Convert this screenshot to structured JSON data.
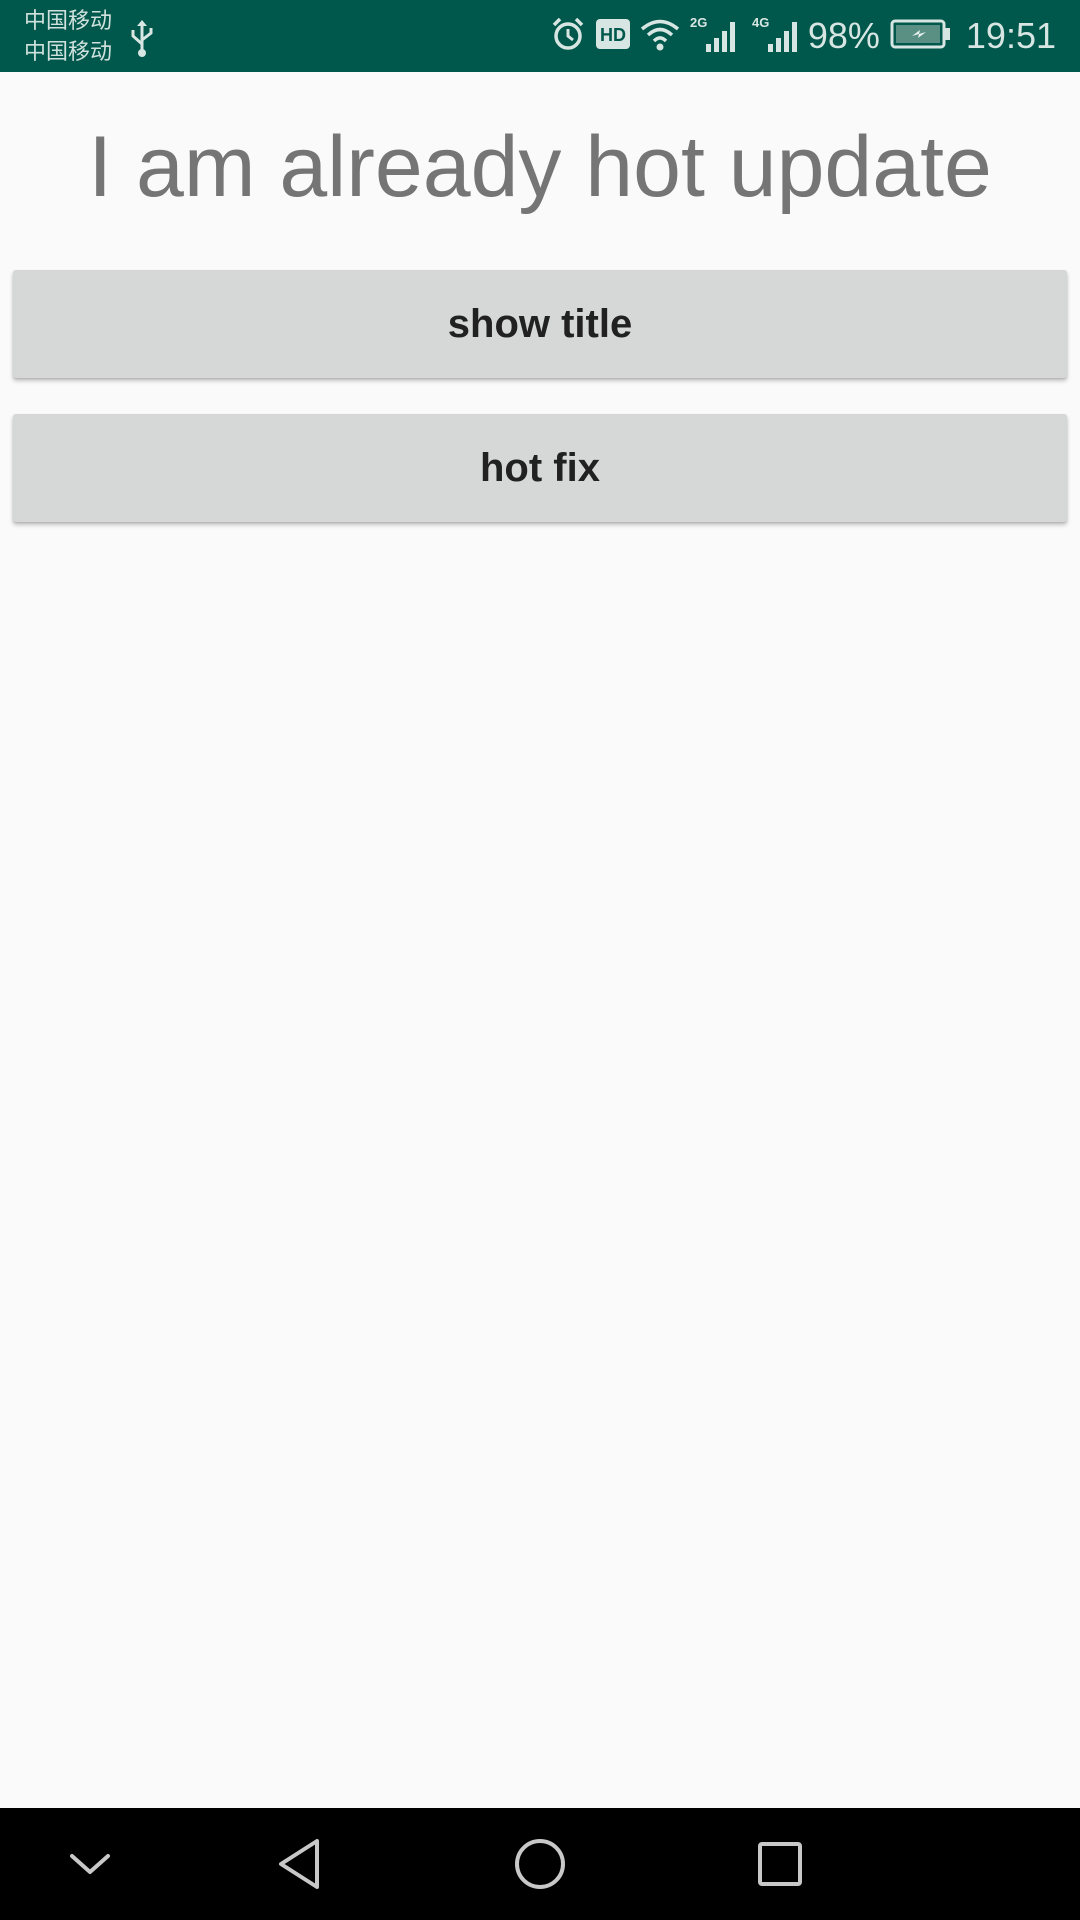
{
  "status_bar": {
    "carrier_1": "中国移动",
    "carrier_2": "中国移动",
    "network_2g": "2G",
    "network_4g": "4G",
    "battery_percent": "98%",
    "time": "19:51",
    "hd_badge": "HD",
    "icons": [
      "usb-icon",
      "alarm-icon",
      "hd-icon",
      "wifi-icon",
      "signal-icon",
      "battery-charging-icon"
    ],
    "background_color": "#00574b"
  },
  "main": {
    "headline": "I am already hot update",
    "buttons": [
      {
        "label": "show title"
      },
      {
        "label": "hot fix"
      }
    ],
    "background_color": "#fafafa",
    "button_color": "#d6d7d7"
  },
  "nav_bar": {
    "icons": [
      "chevron-down-icon",
      "back-triangle-icon",
      "home-circle-icon",
      "recents-square-icon"
    ],
    "background_color": "#000000"
  }
}
